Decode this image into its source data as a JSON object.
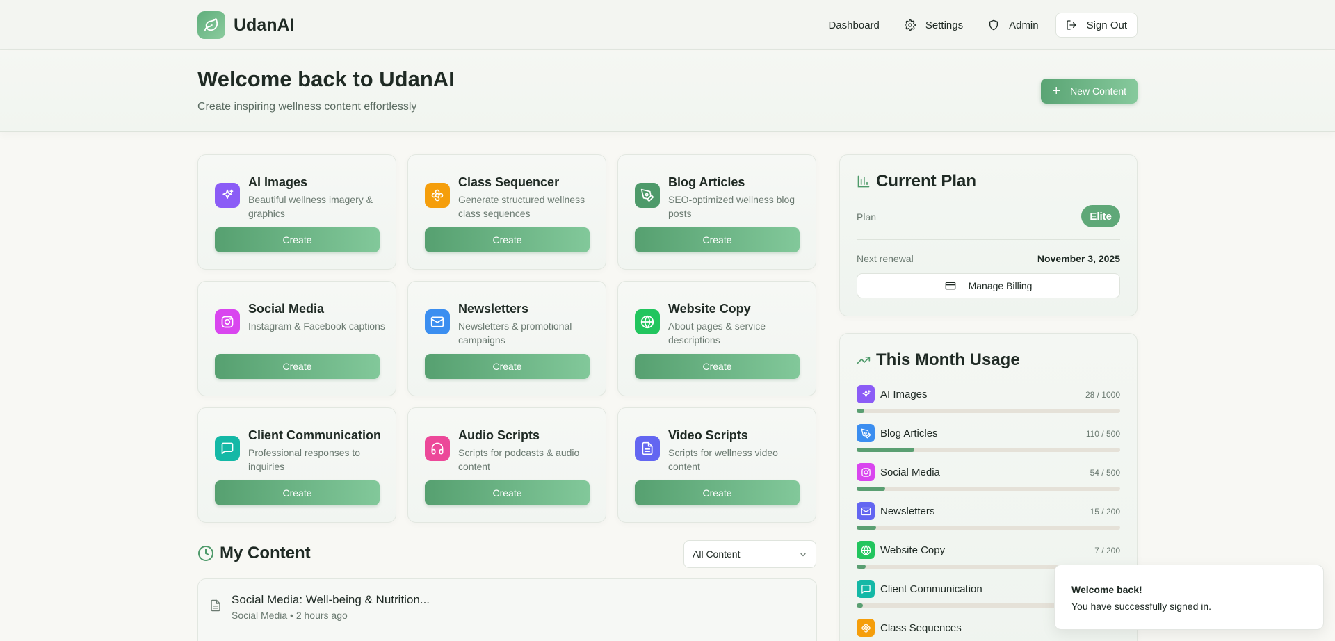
{
  "nav": {
    "brand": "UdanAI",
    "links": [
      {
        "label": "Dashboard",
        "icon": "none"
      },
      {
        "label": "Settings",
        "icon": "gear-icon"
      },
      {
        "label": "Admin",
        "icon": "shield-icon"
      },
      {
        "label": "Sign Out",
        "icon": "logout-icon"
      }
    ]
  },
  "hero": {
    "title": "Welcome back to UdanAI",
    "subtitle": "Create inspiring wellness content effortlessly",
    "new_button": "New Content"
  },
  "tools": [
    {
      "title": "AI Images",
      "desc": "Beautiful wellness imagery & graphics",
      "button": "Create",
      "color": "#8b5cf6",
      "icon": "sparkles-icon"
    },
    {
      "title": "Class Sequencer",
      "desc": "Generate structured wellness class sequences",
      "button": "Create",
      "color": "#f59e0b",
      "icon": "flower-icon"
    },
    {
      "title": "Blog Articles",
      "desc": "SEO-optimized wellness blog posts",
      "button": "Create",
      "color": "#4e9a6a",
      "icon": "pen-tool-icon"
    },
    {
      "title": "Social Media",
      "desc": "Instagram & Facebook captions",
      "button": "Create",
      "color": "#d946ef",
      "icon": "instagram-icon"
    },
    {
      "title": "Newsletters",
      "desc": "Newsletters & promotional campaigns",
      "button": "Create",
      "color": "#3b8ef0",
      "icon": "mail-icon"
    },
    {
      "title": "Website Copy",
      "desc": "About pages & service descriptions",
      "button": "Create",
      "color": "#22c55e",
      "icon": "globe-icon"
    },
    {
      "title": "Client Communication",
      "desc": "Professional responses to inquiries",
      "button": "Create",
      "color": "#14b8a6",
      "icon": "message-square-icon"
    },
    {
      "title": "Audio Scripts",
      "desc": "Scripts for podcasts & audio content",
      "button": "Create",
      "color": "#ec4899",
      "icon": "headphones-icon"
    },
    {
      "title": "Video Scripts",
      "desc": "Scripts for wellness video content",
      "button": "Create",
      "color": "#6366f1",
      "icon": "file-text-icon"
    }
  ],
  "my_content": {
    "title": "My Content",
    "filter_value": "All Content",
    "items": [
      {
        "title": "Social Media: Well-being & Nutrition...",
        "meta": "Social Media • 2 hours ago"
      }
    ]
  },
  "plan": {
    "title": "Current Plan",
    "plan_label": "Plan",
    "plan_value": "Elite",
    "renewal_label": "Next renewal",
    "renewal_value": "November 3, 2025",
    "billing_button": "Manage Billing"
  },
  "usage": {
    "title": "This Month Usage",
    "items": [
      {
        "label": "AI Images",
        "count": "28 / 1000",
        "used": 28,
        "limit": 1000,
        "color": "#8b5cf6",
        "icon": "sparkles-icon"
      },
      {
        "label": "Blog Articles",
        "count": "110 / 500",
        "used": 110,
        "limit": 500,
        "color": "#3b8ef0",
        "icon": "pen-tool-icon"
      },
      {
        "label": "Social Media",
        "count": "54 / 500",
        "used": 54,
        "limit": 500,
        "color": "#d946ef",
        "icon": "instagram-icon"
      },
      {
        "label": "Newsletters",
        "count": "15 / 200",
        "used": 15,
        "limit": 200,
        "color": "#6366f1",
        "icon": "mail-icon"
      },
      {
        "label": "Website Copy",
        "count": "7 / 200",
        "used": 7,
        "limit": 200,
        "color": "#22c55e",
        "icon": "globe-icon"
      },
      {
        "label": "Client Communication",
        "count": "",
        "used": 5,
        "limit": 200,
        "color": "#14b8a6",
        "icon": "message-square-icon"
      },
      {
        "label": "Class Sequences",
        "count": "",
        "used": 0,
        "limit": 200,
        "color": "#f59e0b",
        "icon": "flower-icon"
      }
    ]
  },
  "toast": {
    "title": "Welcome back!",
    "message": "You have successfully signed in."
  }
}
